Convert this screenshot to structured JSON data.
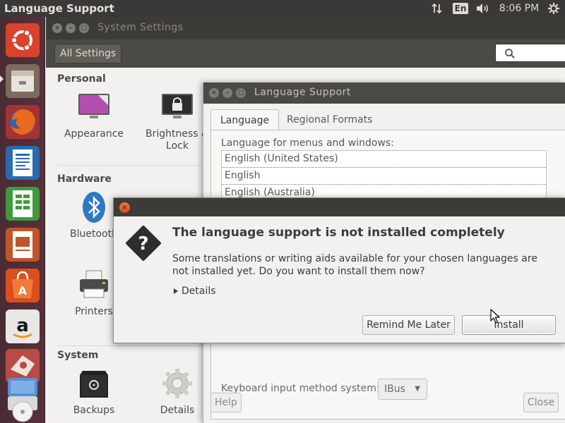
{
  "top_panel": {
    "app_title": "Language Support",
    "keyboard_layout": "En",
    "clock": "8:06 PM",
    "icons": [
      "network-updown-icon",
      "keyboard-layout-indicator",
      "volume-icon",
      "gear-icon"
    ]
  },
  "launcher": {
    "items": [
      "ubuntu-dash-icon",
      "files-icon",
      "firefox-icon",
      "writer-icon",
      "calc-icon",
      "impress-icon",
      "software-center-icon",
      "amazon-icon",
      "system-settings-icon",
      "workspaces-icon",
      "dvd-icon"
    ]
  },
  "settings": {
    "title": "System Settings",
    "all_settings_label": "All Settings",
    "sections": {
      "personal": "Personal",
      "hardware": "Hardware",
      "system": "System"
    },
    "tiles": {
      "appearance": "Appearance",
      "brightness_lock": "Brightness &\nLock",
      "bluetooth": "Bluetooth",
      "printers": "Printers",
      "backups": "Backups",
      "details": "Details"
    }
  },
  "language_support": {
    "title": "Language Support",
    "tabs": [
      "Language",
      "Regional Formats"
    ],
    "menus_label": "Language for menus and windows:",
    "languages": [
      "English (United States)",
      "English",
      "English (Australia)"
    ],
    "keyboard_label": "Keyboard input method system:",
    "keyboard_value": "IBus",
    "help_label": "Help",
    "close_label": "Close"
  },
  "dialog": {
    "heading": "The language support is not installed completely",
    "body": "Some translations or writing aids available for your chosen languages are not installed yet. Do you want to install them now?",
    "details_label": "Details",
    "remind_label": "Remind Me Later",
    "install_label": "Install"
  },
  "colors": {
    "accent_orange": "#e95420",
    "panel_dark": "#3c3b37",
    "launcher": "#56313b"
  }
}
